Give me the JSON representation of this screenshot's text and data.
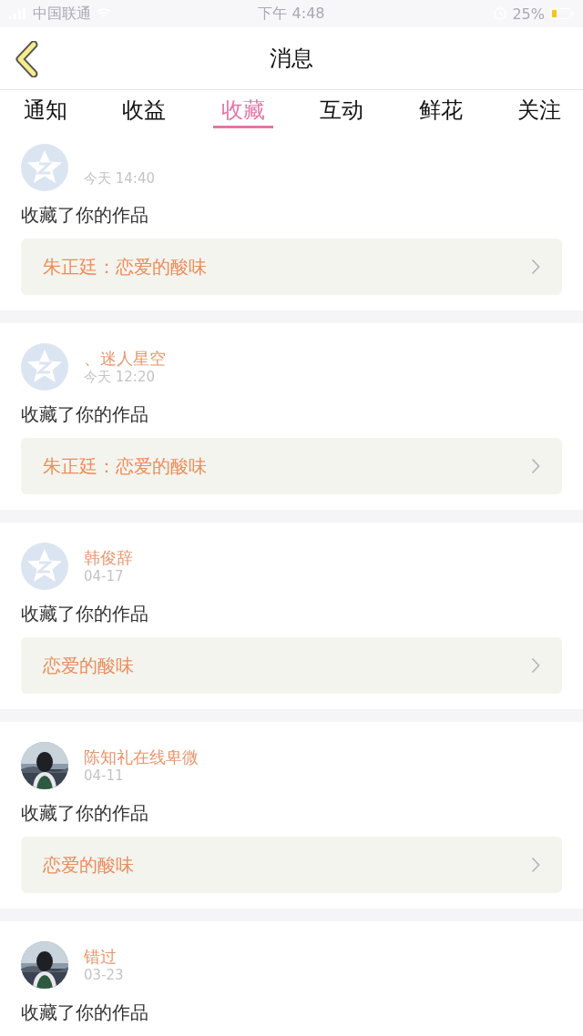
{
  "status_bar": {
    "carrier": "中国联通",
    "time": "下午 4:48",
    "battery": "25%"
  },
  "nav": {
    "title": "消息"
  },
  "tabs": [
    {
      "label": "通知",
      "selected": false
    },
    {
      "label": "收益",
      "selected": false
    },
    {
      "label": "收藏",
      "selected": true
    },
    {
      "label": "互动",
      "selected": false
    },
    {
      "label": "鲜花",
      "selected": false
    },
    {
      "label": "关注",
      "selected": false
    }
  ],
  "messages": [
    {
      "avatar": {
        "kind": "default"
      },
      "date": "今天 14:40",
      "text": "收藏了你的作品",
      "work": "朱正廷：恋爱的酸味"
    },
    {
      "avatar": {
        "kind": "default"
      },
      "name": "、迷人星空",
      "date": "今天 12:20",
      "text": "收藏了你的作品",
      "work": "朱正廷：恋爱的酸味"
    },
    {
      "avatar": {
        "kind": "default"
      },
      "name": "韩俊辞",
      "date": "04-17",
      "text": "收藏了你的作品",
      "work": "恋爱的酸味"
    },
    {
      "name": "陈知礼在线卑微",
      "date": "04-11",
      "text": "收藏了你的作品",
      "work": "恋爱的酸味"
    },
    {
      "name": "错过",
      "date": "03-23",
      "text": "收藏了你的作品"
    }
  ]
}
